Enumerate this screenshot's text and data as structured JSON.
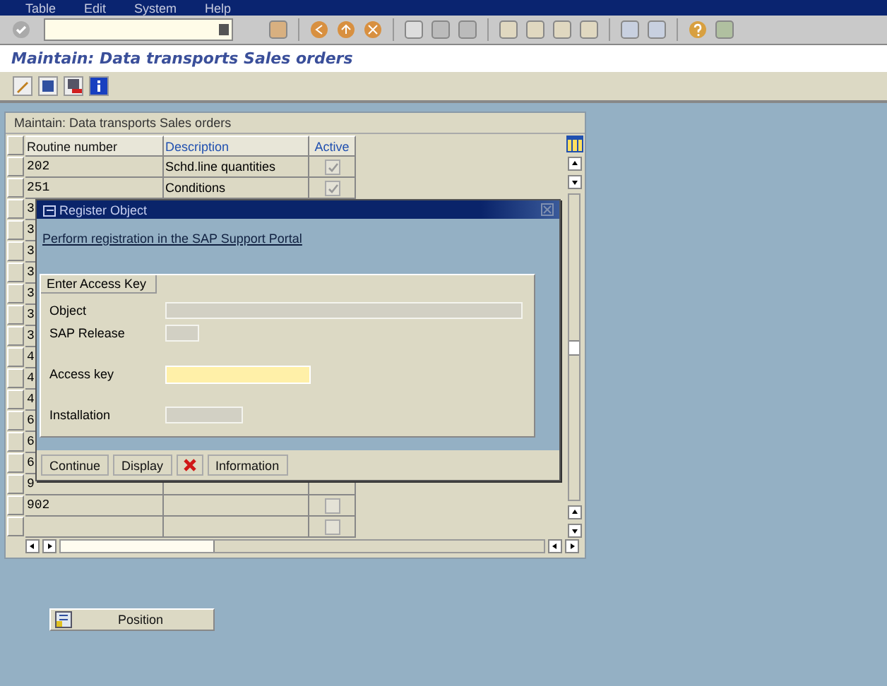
{
  "menu": [
    {
      "label": "Table"
    },
    {
      "label": "Edit"
    },
    {
      "label": "System"
    },
    {
      "label": "Help"
    }
  ],
  "title": "Maintain: Data transports Sales orders",
  "table": {
    "title": "Maintain: Data transports Sales orders",
    "columns": [
      {
        "label": "Routine number",
        "key": true
      },
      {
        "label": "Description",
        "key": false
      },
      {
        "label": "Active",
        "key": false
      }
    ],
    "rows": [
      {
        "number": "202",
        "description": "Schd.line quantities",
        "active": true
      },
      {
        "number": "251",
        "description": "Conditions",
        "active": true
      },
      {
        "number": "3"
      },
      {
        "number": "3"
      },
      {
        "number": "3"
      },
      {
        "number": "3"
      },
      {
        "number": "3"
      },
      {
        "number": "3"
      },
      {
        "number": "3"
      },
      {
        "number": "4"
      },
      {
        "number": "4"
      },
      {
        "number": "4"
      },
      {
        "number": "6"
      },
      {
        "number": "6"
      },
      {
        "number": "6"
      },
      {
        "number": "9"
      },
      {
        "number": "902",
        "active": false
      },
      {
        "active": false
      }
    ]
  },
  "dialog": {
    "title": "Register Object",
    "link": "Perform registration in the SAP Support Portal",
    "group_title": "Enter Access Key",
    "fields": [
      {
        "label": "Object",
        "kind": "display"
      },
      {
        "label": "SAP Release",
        "kind": "display"
      },
      {
        "label": "Access key",
        "kind": "input"
      },
      {
        "label": "Installation",
        "kind": "display"
      }
    ],
    "buttons": [
      {
        "kind": "text",
        "label": "Continue"
      },
      {
        "kind": "text",
        "label": "Display"
      },
      {
        "kind": "cancel"
      },
      {
        "kind": "text",
        "label": "Information"
      }
    ]
  },
  "position_button": {
    "label": "Position"
  }
}
